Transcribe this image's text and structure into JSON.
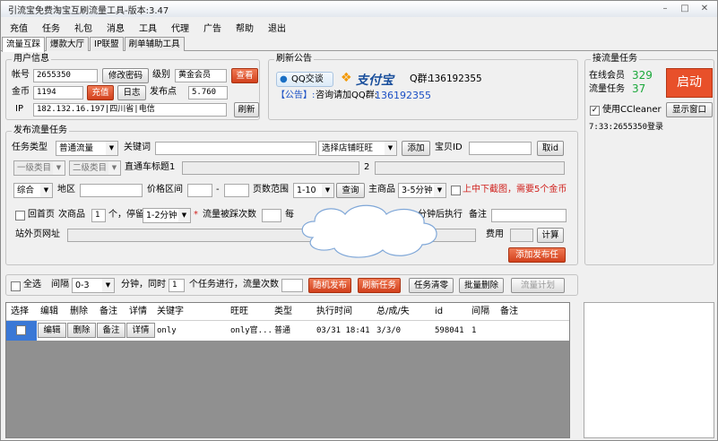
{
  "window": {
    "title": "引流宝免费淘宝互刷流量工具-版本:3.47",
    "min": "–",
    "max": "□",
    "close": "✕"
  },
  "menu": [
    "充值",
    "任务",
    "礼包",
    "消息",
    "工具",
    "代理",
    "广告",
    "帮助",
    "退出"
  ],
  "tabs": [
    "流量互踩",
    "爆款大厅",
    "IP联盟",
    "刷单辅助工具"
  ],
  "user": {
    "title": "用户信息",
    "account_label": "帐号",
    "account": "2655350",
    "change_pwd": "修改密码",
    "level_label": "级别",
    "level": "黄金会员",
    "view": "查看",
    "coins_label": "金币",
    "coins": "1194",
    "recharge": "充值",
    "log": "日志",
    "points_label": "发布点",
    "points": "5.760",
    "ip_label": "IP",
    "ip": "182.132.16.197|四川省|电信",
    "refresh": "刷新"
  },
  "notice": {
    "title": "刷新公告",
    "qq_btn": "QQ交谈",
    "alipay": "支付宝",
    "qq_group_label": "Q群:",
    "qq_group": "136192355",
    "line_prefix": "【公告】:",
    "line_text": "咨询请加QQ群:",
    "line_num": "136192355"
  },
  "receive": {
    "title": "接流量任务",
    "online_label": "在线会员",
    "online": "329",
    "flow_label": "流量任务",
    "flow": "37",
    "start": "启动",
    "ccleaner": "使用CCleaner",
    "ccleaner_checked": "✓",
    "show_window": "显示窗口",
    "log": "7:33:2655350登录"
  },
  "publish": {
    "title": "发布流量任务",
    "task_type_label": "任务类型",
    "task_type": "普通流量",
    "keyword_label": "关键词",
    "shop_select": "选择店铺旺旺",
    "add": "添加",
    "baby_id_label": "宝贝ID",
    "get_id": "取id",
    "cat1": "一级类目",
    "cat2": "二级类目",
    "train_title_label": "直通车标题1",
    "two": "2",
    "sort": "综合",
    "region_label": "地区",
    "price_label": "价格区间",
    "dash": "-",
    "page_label": "页数范围",
    "page": "1-10",
    "query": "查询",
    "main_label": "主商品",
    "main_time": "3-5分钟",
    "up_down": "上中下截图，需要5个金币",
    "back_label": "回首页",
    "sub_label": "次商品",
    "sub_count": "1",
    "stay_label": "个，停留",
    "stay_time": "1-2分钟",
    "star": "*",
    "flow_count_label": "流量被踩次数",
    "every_label": "每",
    "minute_exec": "分钟后执行",
    "remark_label": "备注",
    "url_label": "站外页网址",
    "fee_label": "费用",
    "calc": "计算",
    "add_publish": "添加发布任"
  },
  "bottom": {
    "select_all": "全选",
    "interval_label": "间隔",
    "interval": "0-3",
    "minute_same": "分钟，同时",
    "concurrent": "1",
    "tasks_flow": "个任务进行，流量次数",
    "random_publish": "随机发布",
    "refresh_task": "刷新任务",
    "clear_task": "任务清零",
    "batch_delete": "批量删除",
    "flow_plan": "流量计划"
  },
  "grid": {
    "headers": [
      "选择",
      "编辑",
      "删除",
      "备注",
      "详情",
      "关键字",
      "旺旺",
      "类型",
      "执行时间",
      "总/成/失",
      "id",
      "间隔",
      "备注"
    ],
    "row": {
      "edit": "编辑",
      "delete": "删除",
      "remark": "备注",
      "detail": "详情",
      "keyword": "only",
      "wangwang": "only官...",
      "type": "普通",
      "time": "03/31 18:41",
      "stats": "3/3/0",
      "id": "598041",
      "interval": "1"
    }
  }
}
